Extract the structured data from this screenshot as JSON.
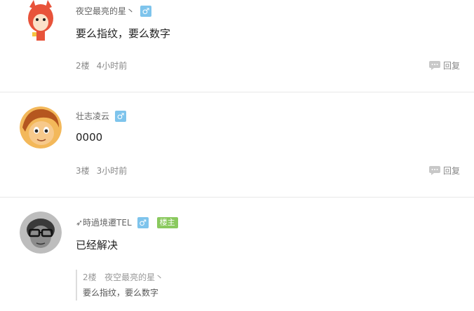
{
  "comments": [
    {
      "username": "夜空最亮的星丶",
      "gender_symbol": "♂",
      "content": "要么指纹，要么数字",
      "floor": "2楼",
      "time": "4小时前",
      "reply_label": "回复"
    },
    {
      "username": "壮志凌云",
      "gender_symbol": "♂",
      "content": "0000",
      "floor": "3楼",
      "time": "3小时前",
      "reply_label": "回复"
    },
    {
      "username": "➶時過境遷TEL",
      "gender_symbol": "♂",
      "badge": "楼主",
      "content": "已经解决",
      "quote": {
        "floor": "2楼",
        "username": "夜空最亮的星丶",
        "text": "要么指纹，要么数字"
      }
    }
  ],
  "colors": {
    "gender_badge": "#7ec4ec",
    "owner_badge": "#8ac95e",
    "divider": "#e8e8e8"
  }
}
